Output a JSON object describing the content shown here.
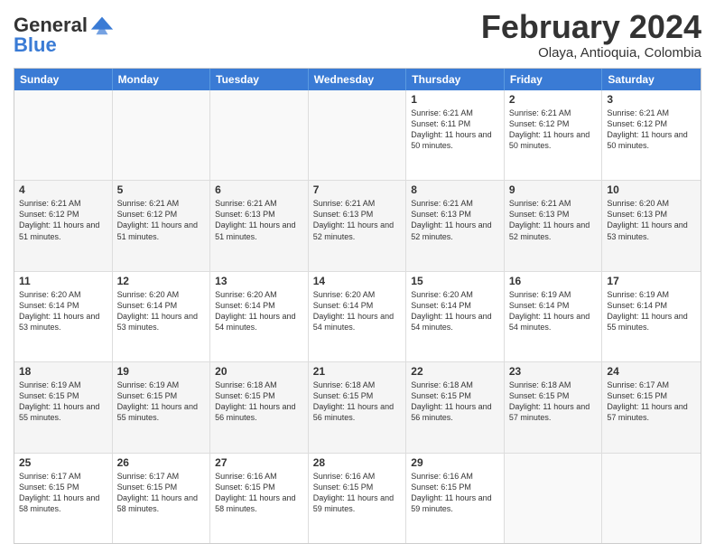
{
  "logo": {
    "general": "General",
    "blue": "Blue"
  },
  "title": "February 2024",
  "subtitle": "Olaya, Antioquia, Colombia",
  "days": [
    "Sunday",
    "Monday",
    "Tuesday",
    "Wednesday",
    "Thursday",
    "Friday",
    "Saturday"
  ],
  "rows": [
    [
      {
        "day": "",
        "text": ""
      },
      {
        "day": "",
        "text": ""
      },
      {
        "day": "",
        "text": ""
      },
      {
        "day": "",
        "text": ""
      },
      {
        "day": "1",
        "text": "Sunrise: 6:21 AM\nSunset: 6:11 PM\nDaylight: 11 hours and 50 minutes."
      },
      {
        "day": "2",
        "text": "Sunrise: 6:21 AM\nSunset: 6:12 PM\nDaylight: 11 hours and 50 minutes."
      },
      {
        "day": "3",
        "text": "Sunrise: 6:21 AM\nSunset: 6:12 PM\nDaylight: 11 hours and 50 minutes."
      }
    ],
    [
      {
        "day": "4",
        "text": "Sunrise: 6:21 AM\nSunset: 6:12 PM\nDaylight: 11 hours and 51 minutes."
      },
      {
        "day": "5",
        "text": "Sunrise: 6:21 AM\nSunset: 6:12 PM\nDaylight: 11 hours and 51 minutes."
      },
      {
        "day": "6",
        "text": "Sunrise: 6:21 AM\nSunset: 6:13 PM\nDaylight: 11 hours and 51 minutes."
      },
      {
        "day": "7",
        "text": "Sunrise: 6:21 AM\nSunset: 6:13 PM\nDaylight: 11 hours and 52 minutes."
      },
      {
        "day": "8",
        "text": "Sunrise: 6:21 AM\nSunset: 6:13 PM\nDaylight: 11 hours and 52 minutes."
      },
      {
        "day": "9",
        "text": "Sunrise: 6:21 AM\nSunset: 6:13 PM\nDaylight: 11 hours and 52 minutes."
      },
      {
        "day": "10",
        "text": "Sunrise: 6:20 AM\nSunset: 6:13 PM\nDaylight: 11 hours and 53 minutes."
      }
    ],
    [
      {
        "day": "11",
        "text": "Sunrise: 6:20 AM\nSunset: 6:14 PM\nDaylight: 11 hours and 53 minutes."
      },
      {
        "day": "12",
        "text": "Sunrise: 6:20 AM\nSunset: 6:14 PM\nDaylight: 11 hours and 53 minutes."
      },
      {
        "day": "13",
        "text": "Sunrise: 6:20 AM\nSunset: 6:14 PM\nDaylight: 11 hours and 54 minutes."
      },
      {
        "day": "14",
        "text": "Sunrise: 6:20 AM\nSunset: 6:14 PM\nDaylight: 11 hours and 54 minutes."
      },
      {
        "day": "15",
        "text": "Sunrise: 6:20 AM\nSunset: 6:14 PM\nDaylight: 11 hours and 54 minutes."
      },
      {
        "day": "16",
        "text": "Sunrise: 6:19 AM\nSunset: 6:14 PM\nDaylight: 11 hours and 54 minutes."
      },
      {
        "day": "17",
        "text": "Sunrise: 6:19 AM\nSunset: 6:14 PM\nDaylight: 11 hours and 55 minutes."
      }
    ],
    [
      {
        "day": "18",
        "text": "Sunrise: 6:19 AM\nSunset: 6:15 PM\nDaylight: 11 hours and 55 minutes."
      },
      {
        "day": "19",
        "text": "Sunrise: 6:19 AM\nSunset: 6:15 PM\nDaylight: 11 hours and 55 minutes."
      },
      {
        "day": "20",
        "text": "Sunrise: 6:18 AM\nSunset: 6:15 PM\nDaylight: 11 hours and 56 minutes."
      },
      {
        "day": "21",
        "text": "Sunrise: 6:18 AM\nSunset: 6:15 PM\nDaylight: 11 hours and 56 minutes."
      },
      {
        "day": "22",
        "text": "Sunrise: 6:18 AM\nSunset: 6:15 PM\nDaylight: 11 hours and 56 minutes."
      },
      {
        "day": "23",
        "text": "Sunrise: 6:18 AM\nSunset: 6:15 PM\nDaylight: 11 hours and 57 minutes."
      },
      {
        "day": "24",
        "text": "Sunrise: 6:17 AM\nSunset: 6:15 PM\nDaylight: 11 hours and 57 minutes."
      }
    ],
    [
      {
        "day": "25",
        "text": "Sunrise: 6:17 AM\nSunset: 6:15 PM\nDaylight: 11 hours and 58 minutes."
      },
      {
        "day": "26",
        "text": "Sunrise: 6:17 AM\nSunset: 6:15 PM\nDaylight: 11 hours and 58 minutes."
      },
      {
        "day": "27",
        "text": "Sunrise: 6:16 AM\nSunset: 6:15 PM\nDaylight: 11 hours and 58 minutes."
      },
      {
        "day": "28",
        "text": "Sunrise: 6:16 AM\nSunset: 6:15 PM\nDaylight: 11 hours and 59 minutes."
      },
      {
        "day": "29",
        "text": "Sunrise: 6:16 AM\nSunset: 6:15 PM\nDaylight: 11 hours and 59 minutes."
      },
      {
        "day": "",
        "text": ""
      },
      {
        "day": "",
        "text": ""
      }
    ]
  ]
}
